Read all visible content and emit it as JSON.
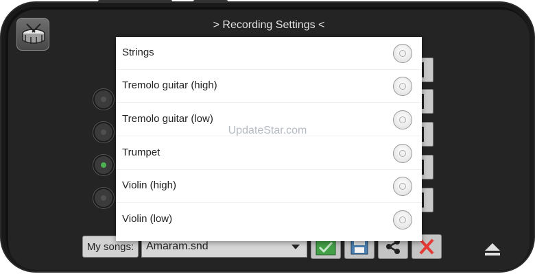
{
  "app": {
    "title": "> Recording Settings <",
    "icon": "drum-icon"
  },
  "dialog": {
    "options": [
      {
        "label": "Strings",
        "selected": false
      },
      {
        "label": "Tremolo guitar (high)",
        "selected": false
      },
      {
        "label": "Tremolo guitar (low)",
        "selected": false
      },
      {
        "label": "Trumpet",
        "selected": false
      },
      {
        "label": "Violin (high)",
        "selected": false
      },
      {
        "label": "Violin (low)",
        "selected": false
      }
    ]
  },
  "background_rows": {
    "radios": [
      {
        "selected": false
      },
      {
        "selected": false
      },
      {
        "selected": true
      },
      {
        "selected": false
      }
    ]
  },
  "bottom_bar": {
    "my_songs_label": "My songs:",
    "song_value": "Amaram.snd",
    "buttons": [
      "checkmark-icon",
      "save-icon",
      "share-icon",
      "close-icon"
    ],
    "eject": "eject-icon"
  },
  "watermark": "UpdateStar.com",
  "colors": {
    "accent_green": "#4caf50",
    "close_red": "#e53935",
    "background": "#242424",
    "dialog_bg": "#ffffff"
  }
}
